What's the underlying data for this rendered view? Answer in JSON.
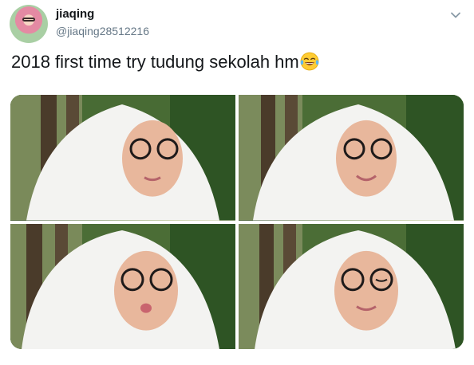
{
  "tweet": {
    "display_name": "jiaqing",
    "handle": "@jiaqing28512216",
    "text": "2018 first time try tudung sekolah hm",
    "emoji": "face-with-tears-of-joy",
    "photos": [
      {
        "label": "photo-1"
      },
      {
        "label": "photo-2"
      },
      {
        "label": "photo-3"
      },
      {
        "label": "photo-4"
      }
    ]
  },
  "icons": {
    "caret": "chevron-down-icon"
  },
  "colors": {
    "name": "#14171a",
    "handle": "#657786",
    "caret": "#8899a6"
  }
}
